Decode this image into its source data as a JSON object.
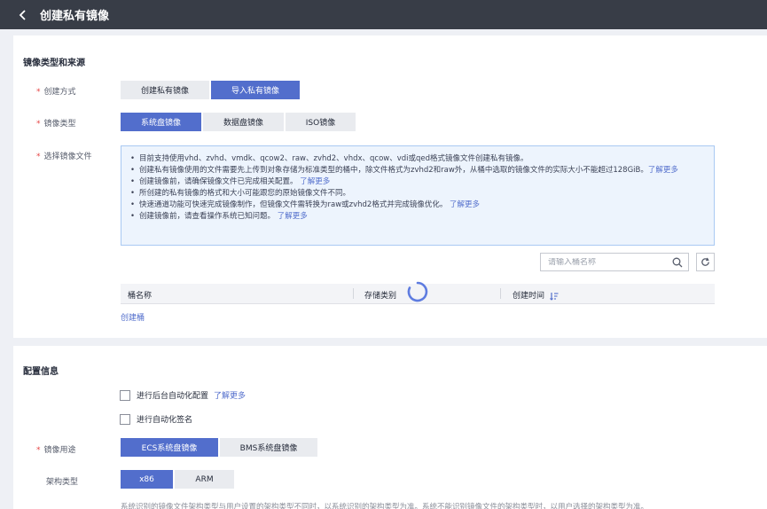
{
  "header": {
    "title": "创建私有镜像"
  },
  "section1": {
    "title": "镜像类型和来源",
    "create_method": {
      "label": "创建方式",
      "options": [
        "创建私有镜像",
        "导入私有镜像"
      ],
      "selected": "导入私有镜像"
    },
    "image_type": {
      "label": "镜像类型",
      "options": [
        "系统盘镜像",
        "数据盘镜像",
        "ISO镜像"
      ],
      "selected": "系统盘镜像"
    },
    "select_file": {
      "label": "选择镜像文件"
    },
    "notice": {
      "items": [
        {
          "text": "目前支持使用vhd、zvhd、vmdk、qcow2、raw、zvhd2、vhdx、qcow、vdi或qed格式镜像文件创建私有镜像。",
          "link": ""
        },
        {
          "text": "创建私有镜像使用的文件需要先上传到对象存储为标准类型的桶中，除文件格式为zvhd2和raw外，从桶中选取的镜像文件的实际大小不能超过128GiB。",
          "link": "了解更多"
        },
        {
          "text": "创建镜像前，请确保镜像文件已完成相关配置。",
          "link": "了解更多"
        },
        {
          "text": "所创建的私有镜像的格式和大小可能跟您的原始镜像文件不同。",
          "link": ""
        },
        {
          "text": "快速通道功能可快速完成镜像制作，但镜像文件需转换为raw或zvhd2格式并完成镜像优化。",
          "link": "了解更多"
        },
        {
          "text": "创建镜像前，请查看操作系统已知问题。",
          "link": "了解更多"
        }
      ]
    },
    "search": {
      "placeholder": "请输入桶名称",
      "value": ""
    },
    "table": {
      "columns": [
        "桶名称",
        "存储类别",
        "创建时间"
      ]
    },
    "create_bucket_link": "创建桶"
  },
  "section2": {
    "title": "配置信息",
    "checkbox_auto_config": {
      "label": "进行后台自动化配置",
      "link": "了解更多",
      "checked": false
    },
    "checkbox_auto_sign": {
      "label": "进行自动化签名",
      "checked": false
    },
    "image_usage": {
      "label": "镜像用途",
      "options": [
        "ECS系统盘镜像",
        "BMS系统盘镜像"
      ],
      "selected": "ECS系统盘镜像"
    },
    "arch_type": {
      "label": "架构类型",
      "options": [
        "x86",
        "ARM"
      ],
      "selected": "x86"
    },
    "arch_hint": "系统识别的镜像文件架构类型与用户设置的架构类型不同时，以系统识别的架构类型为准。系统不能识别镜像文件的架构类型时，以用户选择的架构类型为准。"
  },
  "colors": {
    "accent": "#526ecc",
    "topbar": "#383d47",
    "required": "#e54545"
  }
}
